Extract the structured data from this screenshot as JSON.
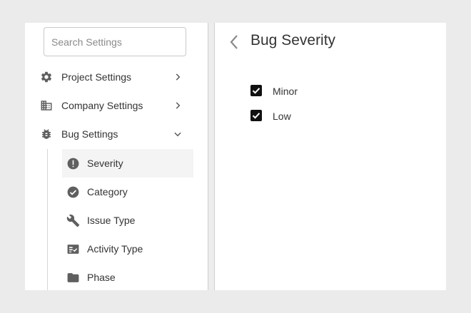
{
  "search": {
    "placeholder": "Search Settings",
    "value": ""
  },
  "sidebar": {
    "items": [
      {
        "label": "Project Settings",
        "icon": "gear-icon",
        "expanded": false
      },
      {
        "label": "Company Settings",
        "icon": "building-icon",
        "expanded": false
      },
      {
        "label": "Bug Settings",
        "icon": "bug-icon",
        "expanded": true
      }
    ],
    "sub_items": [
      {
        "label": "Severity",
        "icon": "alert-circle-icon",
        "active": true
      },
      {
        "label": "Category",
        "icon": "check-circle-icon",
        "active": false
      },
      {
        "label": "Issue Type",
        "icon": "wrench-icon",
        "active": false
      },
      {
        "label": "Activity Type",
        "icon": "list-check-icon",
        "active": false
      },
      {
        "label": "Phase",
        "icon": "folder-icon",
        "active": false
      }
    ]
  },
  "main": {
    "title": "Bug Severity",
    "options": [
      {
        "label": "Minor",
        "checked": true
      },
      {
        "label": "Low",
        "checked": true
      }
    ]
  },
  "colors": {
    "background": "#ebebeb",
    "panel": "#ffffff",
    "active_row": "#f4f4f4",
    "icon": "#5f5f5f",
    "checkbox": "#111111"
  }
}
